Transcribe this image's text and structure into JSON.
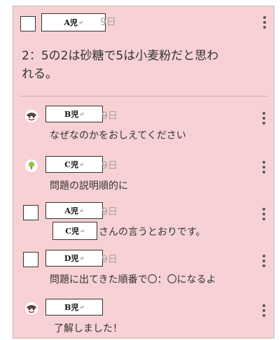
{
  "post": {
    "author": "A児",
    "date": "9日",
    "body_line1": "2：5の2は砂糖で5は小麦粉だと思わ",
    "body_line2": "れる。"
  },
  "comments": [
    {
      "author": "B児",
      "date": "9日",
      "text": "なぜなのかをおしえてください"
    },
    {
      "author": "C児",
      "date": "9日",
      "text": "問題の説明順的に"
    },
    {
      "author": "A児",
      "date": "9日",
      "mention": "C児",
      "text": "さんの言うとおりです。"
    },
    {
      "author": "D児",
      "date": "9日",
      "text": "問題に出てきた順番で〇：〇になるよ"
    },
    {
      "author": "B児",
      "date": "",
      "text": "了解しました！"
    }
  ],
  "label_mark": "↵",
  "icons": {
    "menu": "more-vert-icon",
    "avatar_cartoon": "cartoon-avatar-icon",
    "avatar_tree": "tree-avatar-icon"
  },
  "colors": {
    "card_background": "#f7d1d3",
    "text": "#333333",
    "date": "#a8a1a2"
  }
}
